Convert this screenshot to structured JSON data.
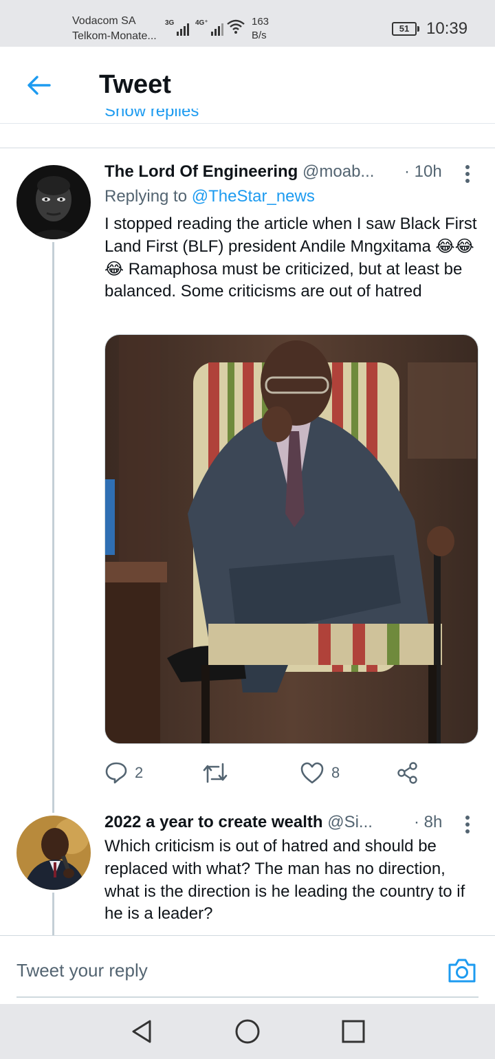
{
  "status_bar": {
    "carrier_1": "Vodacom SA",
    "carrier_2": "Telkom-Monate...",
    "net_1": "3G",
    "net_2": "4G⁺",
    "speed_value": "163",
    "speed_unit": "B/s",
    "battery": "51",
    "time": "10:39"
  },
  "header": {
    "title": "Tweet",
    "back_icon": "arrow-left-icon"
  },
  "thread": {
    "show_replies": "Show replies"
  },
  "tweets": [
    {
      "name": "The Lord Of Engineering",
      "handle": "@moab...",
      "time": "· 10h",
      "replying_prefix": "Replying to",
      "replying_to": "@TheStar_news",
      "text": "I stopped reading the article when I saw Black First Land First (BLF) president Andile Mngxitama 😂😂😂 Ramaphosa must be criticized, but at least be balanced. Some criticisms are out of hatred",
      "replies": "2",
      "retweets": "",
      "likes": "8"
    },
    {
      "name": "2022 a year to create wealth",
      "handle": "@Si...",
      "time": "· 8h",
      "text": "Which criticism is out of hatred and should be replaced with what? The man has no direction, what is the direction is he leading the country to if he is a leader?"
    }
  ],
  "reply_bar": {
    "placeholder": "Tweet your reply"
  },
  "colors": {
    "accent": "#1d9bf0",
    "text": "#0f1419",
    "secondary": "#536471",
    "status_bg": "#e6e7ea"
  }
}
